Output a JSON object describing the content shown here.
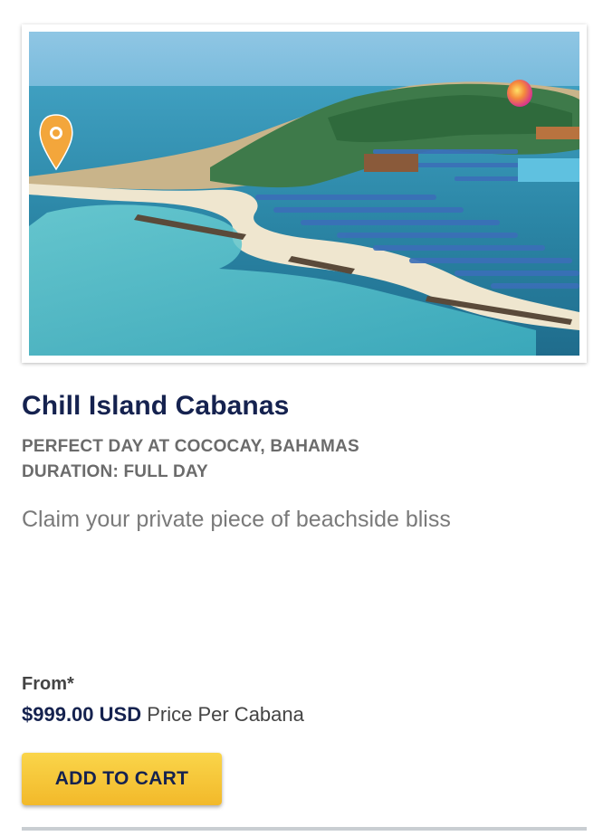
{
  "product": {
    "title": "Chill Island Cabanas",
    "location": "PERFECT DAY AT COCOCAY, BAHAMAS",
    "duration_label": "DURATION:",
    "duration_value": "FULL DAY",
    "description": "Claim your private piece of beachside bliss"
  },
  "pricing": {
    "from_label": "From*",
    "price": "$999.00 USD",
    "unit": "Price Per Cabana"
  },
  "actions": {
    "add_to_cart_label": "ADD TO CART"
  },
  "icons": {
    "map_pin": "location-pin-icon"
  },
  "colors": {
    "title": "#15224f",
    "button": "#f5c233",
    "muted_text": "#6b6b6b",
    "divider": "#c9ced2"
  }
}
